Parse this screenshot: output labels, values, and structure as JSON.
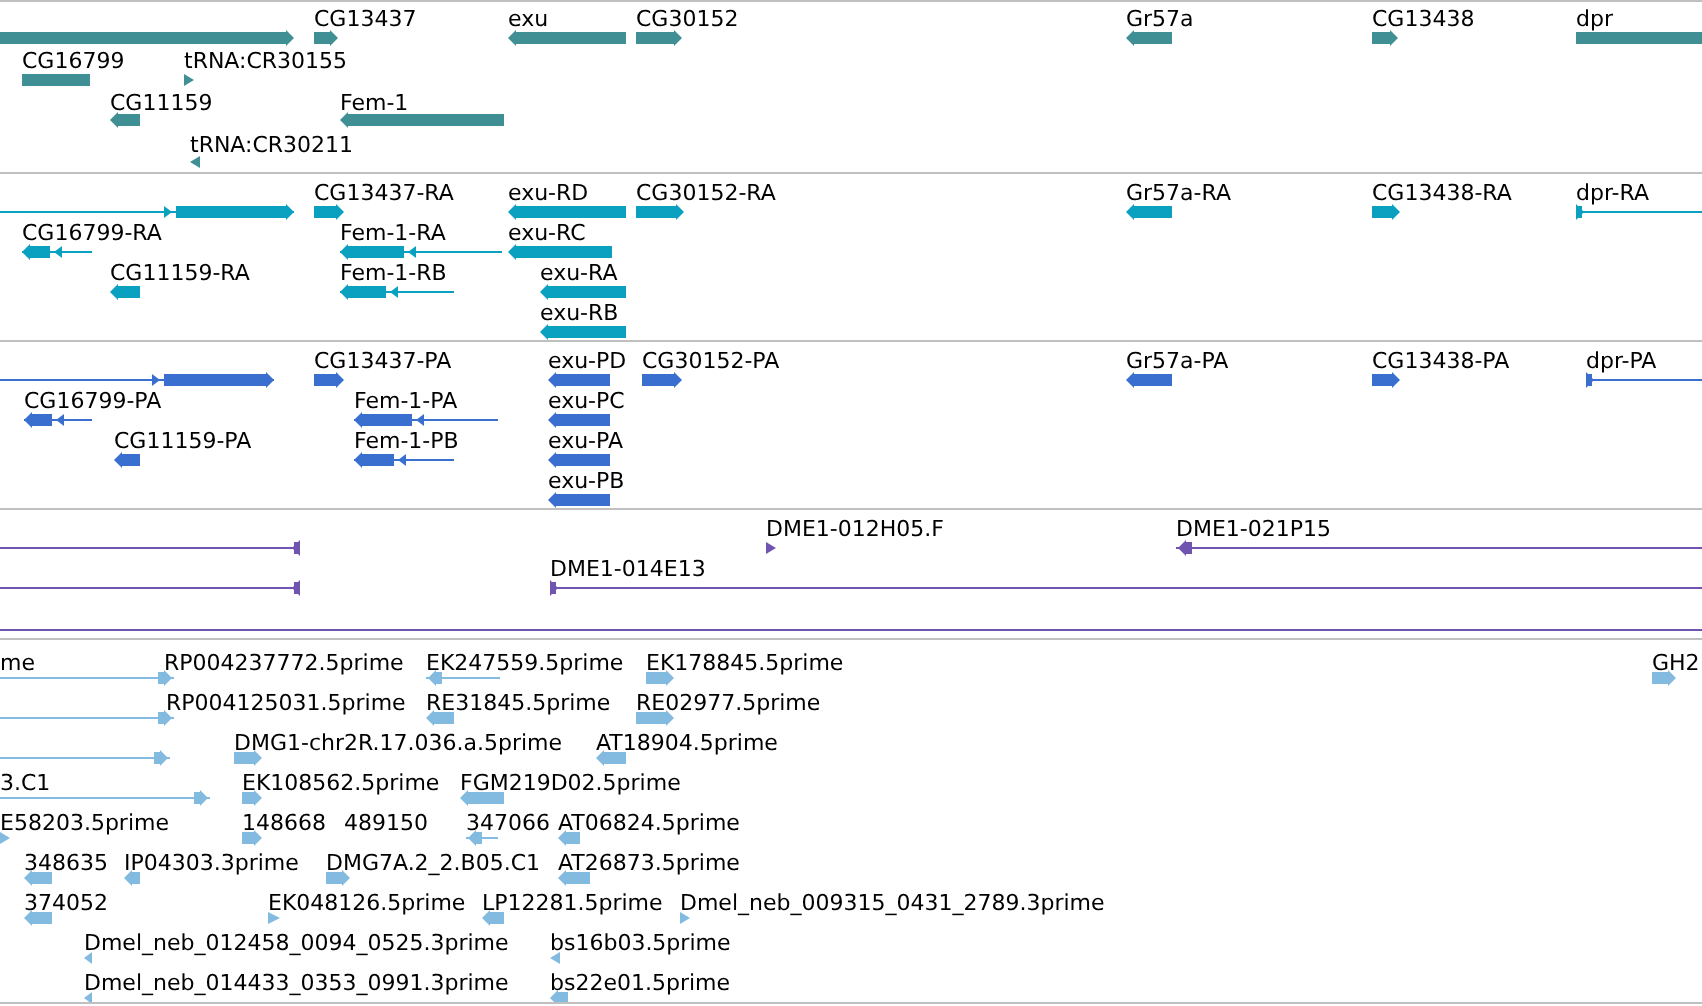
{
  "tracks": [
    {
      "color": "#3f8f94",
      "features": [
        {
          "reverse": false
        },
        {
          "label": "CG13437",
          "reverse": false
        },
        {
          "label": "exu",
          "reverse": true
        },
        {
          "label": "CG30152",
          "reverse": false
        },
        {
          "label": "Gr57a",
          "reverse": true
        },
        {
          "label": "CG13438",
          "reverse": false
        },
        {
          "label": "dpr",
          "arrowhead": false
        },
        {
          "label": "CG16799",
          "arrowhead": false
        },
        {
          "label": "tRNA:CR30155",
          "reverse": false
        },
        {
          "label": "CG11159",
          "reverse": true
        },
        {
          "label": "Fem-1",
          "reverse": true
        },
        {
          "label": "tRNA:CR30211",
          "reverse": true
        }
      ]
    },
    {
      "color": "#0aa0c0",
      "features": [
        {
          "reverse": false
        },
        {
          "label": "CG13437-RA",
          "reverse": false
        },
        {
          "label": "exu-RD",
          "reverse": true
        },
        {
          "label": "CG30152-RA",
          "reverse": false
        },
        {
          "label": "Gr57a-RA",
          "reverse": true
        },
        {
          "label": "CG13438-RA",
          "reverse": false
        },
        {
          "label": "dpr-RA",
          "reverse": false
        },
        {
          "label": "CG16799-RA",
          "reverse": true
        },
        {
          "label": "Fem-1-RA",
          "reverse": true
        },
        {
          "label": "exu-RC",
          "reverse": true
        },
        {
          "label": "CG11159-RA",
          "reverse": true
        },
        {
          "label": "Fem-1-RB",
          "reverse": true
        },
        {
          "label": "exu-RA",
          "reverse": true
        },
        {
          "label": "exu-RB",
          "reverse": true
        }
      ]
    },
    {
      "color": "#3a6fd0",
      "features": [
        {
          "reverse": false
        },
        {
          "label": "CG13437-PA",
          "reverse": false
        },
        {
          "label": "exu-PD",
          "reverse": true
        },
        {
          "label": "CG30152-PA",
          "reverse": false
        },
        {
          "label": "Gr57a-PA",
          "reverse": true
        },
        {
          "label": "CG13438-PA",
          "reverse": false
        },
        {
          "label": "dpr-PA",
          "reverse": false
        },
        {
          "label": "CG16799-PA",
          "reverse": true
        },
        {
          "label": "Fem-1-PA",
          "reverse": true
        },
        {
          "label": "exu-PC",
          "reverse": true
        },
        {
          "label": "CG11159-PA",
          "reverse": true
        },
        {
          "label": "Fem-1-PB",
          "reverse": true
        },
        {
          "label": "exu-PA",
          "reverse": true
        },
        {
          "label": "exu-PB",
          "reverse": true
        }
      ]
    },
    {
      "color": "#7055b0",
      "features": [
        {
          "reverse": true
        },
        {
          "label": "DME1-012H05.F",
          "reverse": false
        },
        {
          "label": "DME1-021P15",
          "reverse": true
        },
        {
          "reverse": true
        },
        {
          "label": "DME1-014E13",
          "reverse": false
        },
        {
          "arrowhead": false
        }
      ]
    },
    {
      "color": "#82bae0",
      "features": [
        {
          "label": "me",
          "reverse": false
        },
        {
          "label": "RP004237772.5prime"
        },
        {
          "label": "EK247559.5prime",
          "reverse": true
        },
        {
          "label": "EK178845.5prime",
          "reverse": false
        },
        {
          "label": "GH2",
          "reverse": false
        },
        {
          "label": "RP004125031.5prime",
          "reverse": false
        },
        {
          "label": "RE31845.5prime",
          "reverse": true
        },
        {
          "label": "RE02977.5prime",
          "reverse": false
        },
        {
          "reverse": false
        },
        {
          "label": "DMG1-chr2R.17.036.a.5prime",
          "reverse": false
        },
        {
          "label": "AT18904.5prime",
          "reverse": true
        },
        {
          "label": "3.C1",
          "reverse": false
        },
        {
          "label": "EK108562.5prime",
          "reverse": false
        },
        {
          "label": "FGM219D02.5prime",
          "reverse": true
        },
        {
          "label": "E58203.5prime",
          "reverse": false
        },
        {
          "label": "148668",
          "reverse": false
        },
        {
          "label": "489150"
        },
        {
          "label": "347066",
          "reverse": true
        },
        {
          "label": "AT06824.5prime",
          "reverse": true
        },
        {
          "label": "348635",
          "reverse": true
        },
        {
          "label": "IP04303.3prime",
          "reverse": true
        },
        {
          "label": "DMG7A.2_2.B05.C1",
          "reverse": false
        },
        {
          "label": "AT26873.5prime",
          "reverse": true
        },
        {
          "label": "374052",
          "reverse": true
        },
        {
          "label": "EK048126.5prime",
          "reverse": false
        },
        {
          "label": "LP12281.5prime",
          "reverse": true
        },
        {
          "label": "Dmel_neb_009315_0431_2789.3prime",
          "reverse": false
        },
        {
          "label": "Dmel_neb_012458_0094_0525.3prime",
          "reverse": true
        },
        {
          "label": "bs16b03.5prime",
          "reverse": true
        },
        {
          "label": "Dmel_neb_014433_0353_0991.3prime",
          "reverse": true
        },
        {
          "label": "bs22e01.5prime",
          "reverse": true
        }
      ]
    }
  ]
}
